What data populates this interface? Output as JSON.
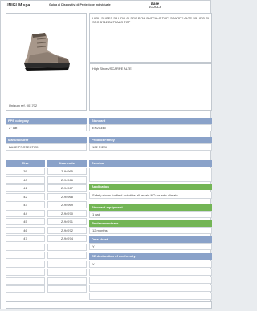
{
  "header": {
    "brand": "UNIGUM spa",
    "subtitle": "Guida ai Dispositivi di Protezione Individuale",
    "logo_top": "Base",
    "logo_bottom": "SCUOLA"
  },
  "product": {
    "description": "HIGH SHOES S3 HRO CI SRC B712 BUFFALO TOP/ SCARPE ALTE S3 HRO CI SRC B712 BUFFALO TOP",
    "category": "High Shoes/SCARPE ALTE",
    "reference": "Unigum ref. 001702"
  },
  "left_sections": [
    {
      "label": "PPE category",
      "value": "2° cat"
    },
    {
      "label": "Manufacturer",
      "value": "BASE PROTECTION"
    }
  ],
  "sizes": {
    "headers": [
      "Size",
      "Item code"
    ],
    "rows": [
      [
        "39",
        "Z-94965"
      ],
      [
        "40",
        "Z-94966"
      ],
      [
        "41",
        "Z-94967"
      ],
      [
        "42",
        "Z-94968"
      ],
      [
        "43",
        "Z-94969"
      ],
      [
        "44",
        "Z-94970"
      ],
      [
        "45",
        "Z-94971"
      ],
      [
        "46",
        "Z-94972"
      ],
      [
        "47",
        "Z-94974"
      ]
    ]
  },
  "right_sections": [
    {
      "label": "Standard",
      "value": "EN20345"
    },
    {
      "label": "Product Family",
      "value": "102 PIEDI"
    },
    {
      "label": "Session",
      "value": ""
    },
    {
      "label": "Application",
      "value": "Safety shoes for field activities all terrain NO for artic climate"
    },
    {
      "label": "Standard equipment",
      "value": "1 pair"
    },
    {
      "label": "Replacement rate",
      "value": "12 months"
    },
    {
      "label": "Data sheet",
      "value": "Y"
    },
    {
      "label": "CE declaration of conformity",
      "value": "Y"
    }
  ],
  "colors": {
    "header_blue": "#8aa2c9",
    "header_green": "#73b555"
  },
  "icons": {
    "product_image": "boot-image"
  }
}
